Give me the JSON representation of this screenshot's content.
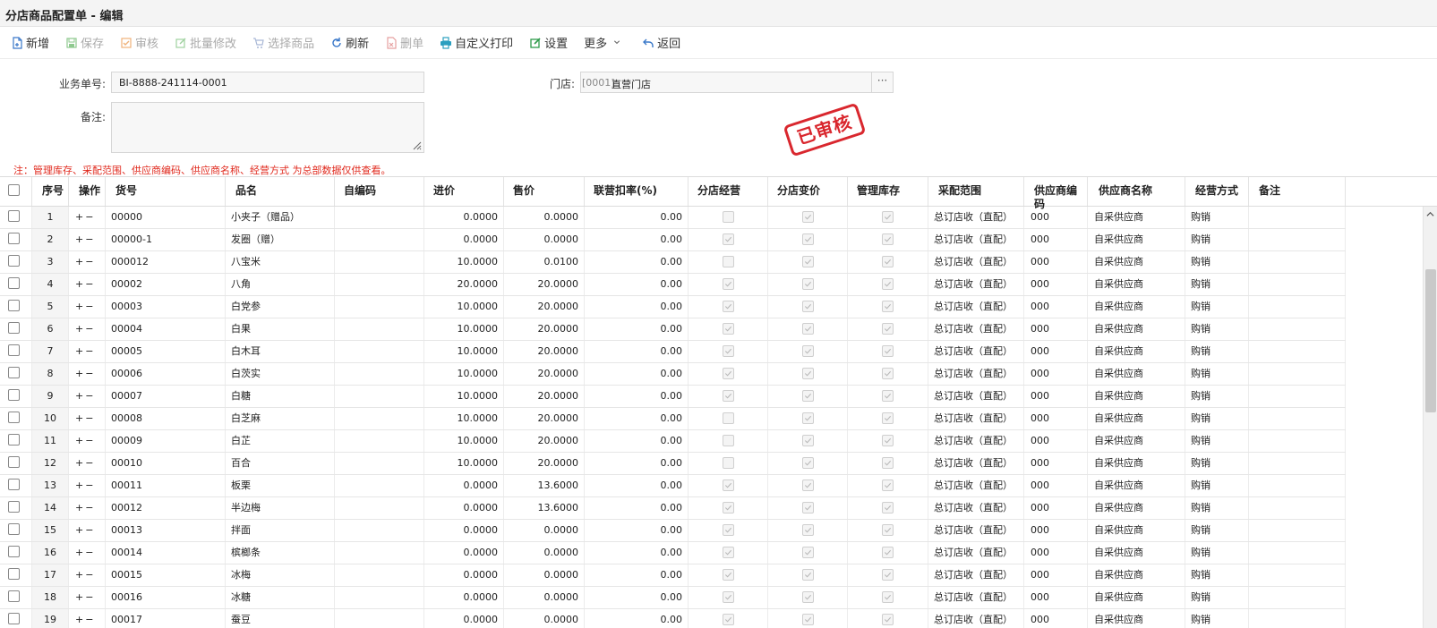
{
  "window": {
    "title": "分店商品配置单 - 编辑"
  },
  "toolbar": {
    "new": "新增",
    "save": "保存",
    "audit": "审核",
    "batch_edit": "批量修改",
    "select_goods": "选择商品",
    "refresh": "刷新",
    "delete": "删单",
    "custom_print": "自定义打印",
    "settings": "设置",
    "more": "更多",
    "back": "返回"
  },
  "form": {
    "order_no_label": "业务单号:",
    "order_no": "BI-8888-241114-0001",
    "store_label": "门店:",
    "store_code": "[0001]",
    "store_name": "直营门店",
    "store_more": "···",
    "remark_label": "备注:",
    "remark": ""
  },
  "stamp": {
    "text": "已审核",
    "color": "#d9272e"
  },
  "note": "注：管理库存、采配范围、供应商编码、供应商名称、经营方式 为总部数据仅供查看。",
  "columns": {
    "seq": "序号",
    "op": "操作",
    "code": "货号",
    "name": "品名",
    "self_code": "自编码",
    "in_price": "进价",
    "sale_price": "售价",
    "discount": "联营扣率(%)",
    "branch_manage": "分店经营",
    "branch_price": "分店变价",
    "manage_stock": "管理库存",
    "purchase_scope": "采配范围",
    "supplier_code": "供应商编码",
    "supplier_name": "供应商名称",
    "mode": "经营方式",
    "remark": "备注"
  },
  "ops_glyphs": "+ −",
  "rows": [
    {
      "seq": "1",
      "code": "00000",
      "name": "小夹子（赠品）",
      "in": "0.0000",
      "sale": "0.0000",
      "disc": "0.00",
      "bm": false,
      "scope": "总订店收（直配）",
      "sup_code": "000",
      "sup_name": "自采供应商",
      "mode": "购销"
    },
    {
      "seq": "2",
      "code": "00000-1",
      "name": "发圈（赠）",
      "in": "0.0000",
      "sale": "0.0000",
      "disc": "0.00",
      "bm": true,
      "scope": "总订店收（直配）",
      "sup_code": "000",
      "sup_name": "自采供应商",
      "mode": "购销"
    },
    {
      "seq": "3",
      "code": "000012",
      "name": "八宝米",
      "in": "10.0000",
      "sale": "0.0100",
      "disc": "0.00",
      "bm": false,
      "scope": "总订店收（直配）",
      "sup_code": "000",
      "sup_name": "自采供应商",
      "mode": "购销"
    },
    {
      "seq": "4",
      "code": "00002",
      "name": "八角",
      "in": "20.0000",
      "sale": "20.0000",
      "disc": "0.00",
      "bm": true,
      "scope": "总订店收（直配）",
      "sup_code": "000",
      "sup_name": "自采供应商",
      "mode": "购销"
    },
    {
      "seq": "5",
      "code": "00003",
      "name": "白党参",
      "in": "10.0000",
      "sale": "20.0000",
      "disc": "0.00",
      "bm": true,
      "scope": "总订店收（直配）",
      "sup_code": "000",
      "sup_name": "自采供应商",
      "mode": "购销"
    },
    {
      "seq": "6",
      "code": "00004",
      "name": "白果",
      "in": "10.0000",
      "sale": "20.0000",
      "disc": "0.00",
      "bm": true,
      "scope": "总订店收（直配）",
      "sup_code": "000",
      "sup_name": "自采供应商",
      "mode": "购销"
    },
    {
      "seq": "7",
      "code": "00005",
      "name": "白木耳",
      "in": "10.0000",
      "sale": "20.0000",
      "disc": "0.00",
      "bm": true,
      "scope": "总订店收（直配）",
      "sup_code": "000",
      "sup_name": "自采供应商",
      "mode": "购销"
    },
    {
      "seq": "8",
      "code": "00006",
      "name": "白茨实",
      "in": "10.0000",
      "sale": "20.0000",
      "disc": "0.00",
      "bm": true,
      "scope": "总订店收（直配）",
      "sup_code": "000",
      "sup_name": "自采供应商",
      "mode": "购销"
    },
    {
      "seq": "9",
      "code": "00007",
      "name": "白糖",
      "in": "10.0000",
      "sale": "20.0000",
      "disc": "0.00",
      "bm": true,
      "scope": "总订店收（直配）",
      "sup_code": "000",
      "sup_name": "自采供应商",
      "mode": "购销"
    },
    {
      "seq": "10",
      "code": "00008",
      "name": "白芝麻",
      "in": "10.0000",
      "sale": "20.0000",
      "disc": "0.00",
      "bm": false,
      "scope": "总订店收（直配）",
      "sup_code": "000",
      "sup_name": "自采供应商",
      "mode": "购销"
    },
    {
      "seq": "11",
      "code": "00009",
      "name": "白芷",
      "in": "10.0000",
      "sale": "20.0000",
      "disc": "0.00",
      "bm": false,
      "scope": "总订店收（直配）",
      "sup_code": "000",
      "sup_name": "自采供应商",
      "mode": "购销"
    },
    {
      "seq": "12",
      "code": "00010",
      "name": "百合",
      "in": "10.0000",
      "sale": "20.0000",
      "disc": "0.00",
      "bm": false,
      "scope": "总订店收（直配）",
      "sup_code": "000",
      "sup_name": "自采供应商",
      "mode": "购销"
    },
    {
      "seq": "13",
      "code": "00011",
      "name": "板栗",
      "in": "0.0000",
      "sale": "13.6000",
      "disc": "0.00",
      "bm": true,
      "scope": "总订店收（直配）",
      "sup_code": "000",
      "sup_name": "自采供应商",
      "mode": "购销"
    },
    {
      "seq": "14",
      "code": "00012",
      "name": "半边梅",
      "in": "0.0000",
      "sale": "13.6000",
      "disc": "0.00",
      "bm": true,
      "scope": "总订店收（直配）",
      "sup_code": "000",
      "sup_name": "自采供应商",
      "mode": "购销"
    },
    {
      "seq": "15",
      "code": "00013",
      "name": "拌面",
      "in": "0.0000",
      "sale": "0.0000",
      "disc": "0.00",
      "bm": true,
      "scope": "总订店收（直配）",
      "sup_code": "000",
      "sup_name": "自采供应商",
      "mode": "购销"
    },
    {
      "seq": "16",
      "code": "00014",
      "name": "槟榔条",
      "in": "0.0000",
      "sale": "0.0000",
      "disc": "0.00",
      "bm": true,
      "scope": "总订店收（直配）",
      "sup_code": "000",
      "sup_name": "自采供应商",
      "mode": "购销"
    },
    {
      "seq": "17",
      "code": "00015",
      "name": "冰梅",
      "in": "0.0000",
      "sale": "0.0000",
      "disc": "0.00",
      "bm": true,
      "scope": "总订店收（直配）",
      "sup_code": "000",
      "sup_name": "自采供应商",
      "mode": "购销"
    },
    {
      "seq": "18",
      "code": "00016",
      "name": "冰糖",
      "in": "0.0000",
      "sale": "0.0000",
      "disc": "0.00",
      "bm": true,
      "scope": "总订店收（直配）",
      "sup_code": "000",
      "sup_name": "自采供应商",
      "mode": "购销"
    },
    {
      "seq": "19",
      "code": "00017",
      "name": "蚕豆",
      "in": "0.0000",
      "sale": "0.0000",
      "disc": "0.00",
      "bm": true,
      "scope": "总订店收（直配）",
      "sup_code": "000",
      "sup_name": "自采供应商",
      "mode": "购销"
    }
  ]
}
